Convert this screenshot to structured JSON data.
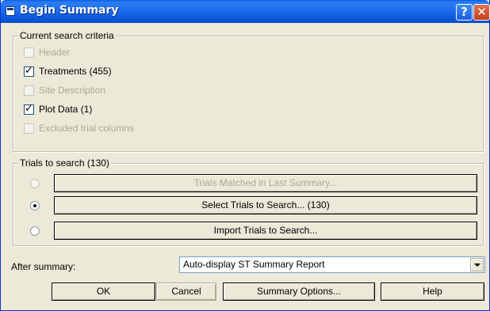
{
  "window": {
    "title": "Begin Summary",
    "help_glyph": "?",
    "close_glyph": "✕"
  },
  "criteria": {
    "legend": "Current search criteria",
    "items": [
      {
        "label": "Header",
        "checked": false,
        "enabled": false
      },
      {
        "label": "Treatments (455)",
        "checked": true,
        "enabled": true
      },
      {
        "label": "Site Description",
        "checked": false,
        "enabled": false
      },
      {
        "label": "Plot Data (1)",
        "checked": true,
        "enabled": true
      },
      {
        "label": "Excluded trial columns",
        "checked": false,
        "enabled": false
      }
    ]
  },
  "trials": {
    "legend": "Trials to search (130)",
    "options": [
      {
        "label": "Trials Matched in Last Summary...",
        "selected": false,
        "enabled": false
      },
      {
        "label": "Select Trials to Search... (130)",
        "selected": true,
        "enabled": true
      },
      {
        "label": "Import Trials to Search...",
        "selected": false,
        "enabled": true
      }
    ]
  },
  "after_summary": {
    "label": "After summary:",
    "value": "Auto-display ST Summary Report"
  },
  "buttons": {
    "ok": "OK",
    "cancel": "Cancel",
    "summary_options": "Summary Options...",
    "help": "Help"
  }
}
